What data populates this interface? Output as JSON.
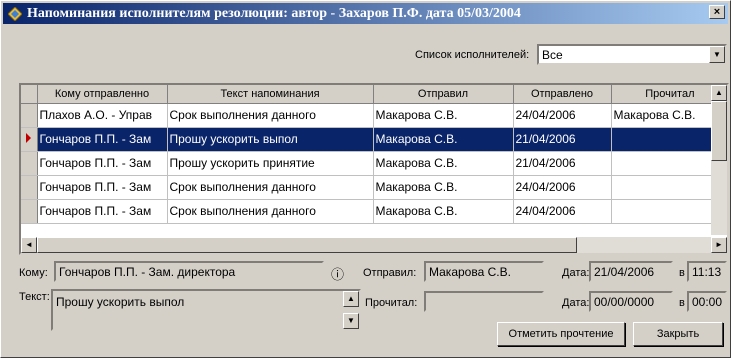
{
  "window": {
    "title": "Напоминания исполнителям резолюции: автор - Захаров П.Ф. дата 05/03/2004",
    "close_symbol": "×",
    "title_icon": "diamond-app-icon"
  },
  "filter": {
    "label": "Список исполнителей:",
    "value": "Все"
  },
  "grid": {
    "columns": [
      "Кому отправленно",
      "Текст напоминания",
      "Отправил",
      "Отправлено",
      "Прочитал"
    ],
    "rows": [
      [
        "Плахов А.О. - Управ",
        "Срок выполнения данного",
        "Макарова С.В.",
        "24/04/2006",
        "Макарова С.В."
      ],
      [
        "Гончаров П.П. - Зам",
        "Прошу ускорить выпол",
        "Макарова С.В.",
        "21/04/2006",
        ""
      ],
      [
        "Гончаров П.П. - Зам",
        "Прошу ускорить принятие",
        "Макарова С.В.",
        "21/04/2006",
        ""
      ],
      [
        "Гончаров П.П. - Зам",
        "Срок выполнения данного",
        "Макарова С.В.",
        "24/04/2006",
        ""
      ],
      [
        "Гончаров П.П. - Зам",
        "Срок выполнения данного",
        "Макарова С.В.",
        "24/04/2006",
        ""
      ]
    ],
    "selected_row": 1
  },
  "details": {
    "to_label": "Кому:",
    "to_value": "Гончаров П.П. - Зам. директора",
    "sender_label": "Отправил:",
    "sender_value": "Макарова С.В.",
    "sent_date_label": "Дата:",
    "sent_date_value": "21/04/2006",
    "sent_time_prefix": "в",
    "sent_time_value": "11:13",
    "text_label": "Текст:",
    "text_value": "Прошу ускорить выпол",
    "reader_label": "Прочитал:",
    "reader_value": "",
    "read_date_label": "Дата:",
    "read_date_value": "00/00/0000",
    "read_time_prefix": "в",
    "read_time_value": "00:00"
  },
  "buttons": {
    "mark_read": "Отметить прочтение",
    "close": "Закрыть"
  }
}
